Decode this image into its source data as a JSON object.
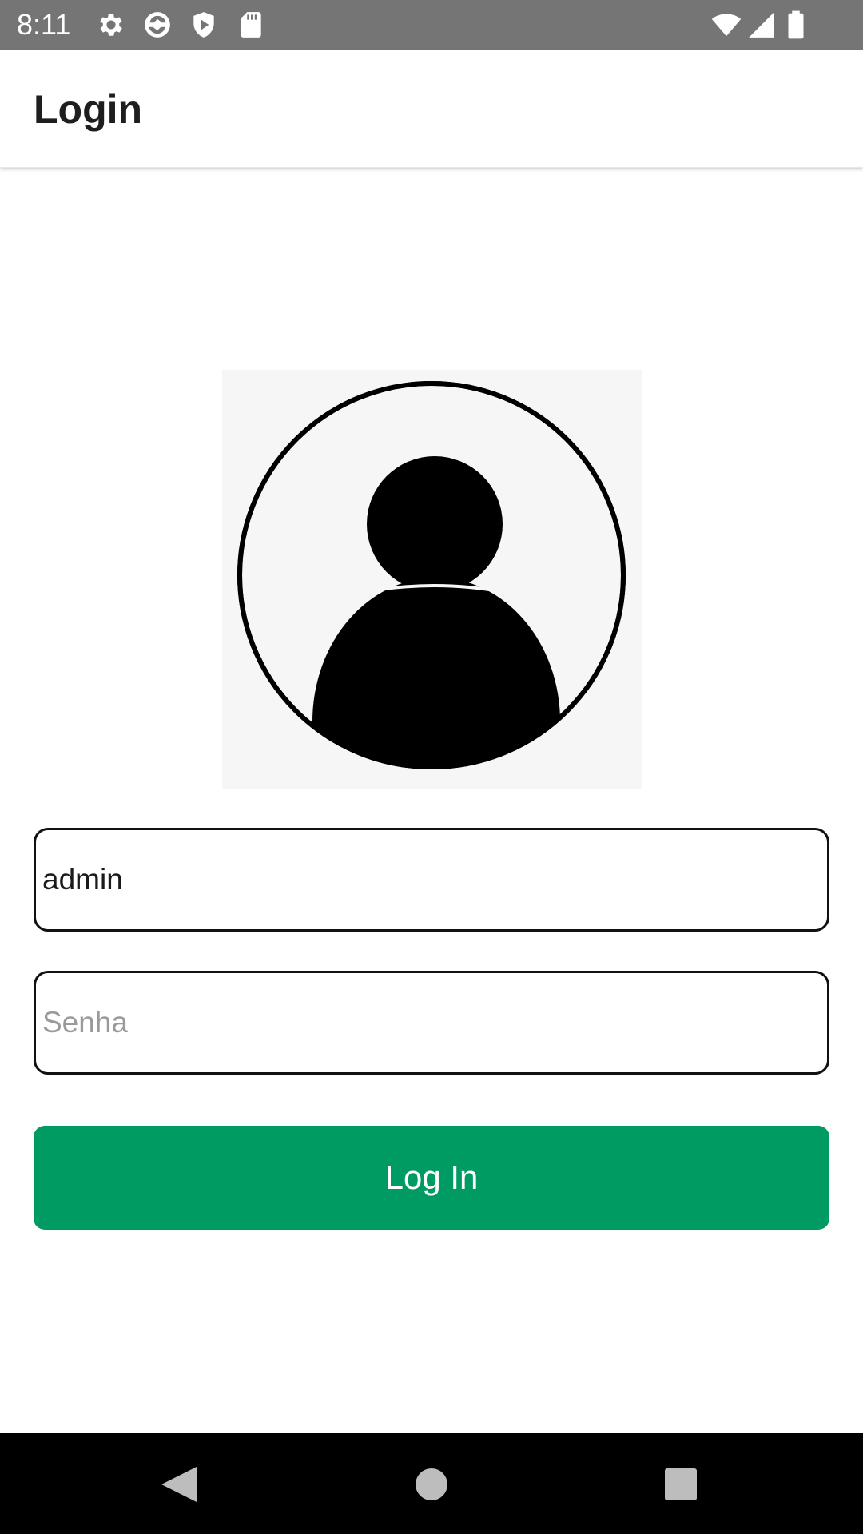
{
  "status_bar": {
    "time": "8:11",
    "icons": [
      "gear-icon",
      "sync-icon",
      "shield-play-icon",
      "sd-card-icon",
      "wifi-icon",
      "cell-signal-icon",
      "battery-icon"
    ]
  },
  "app_bar": {
    "title": "Login"
  },
  "avatar": {
    "icon": "user-avatar-icon"
  },
  "form": {
    "username_value": "admin",
    "password_placeholder": "Senha",
    "login_label": "Log In"
  },
  "nav_bar": {
    "icons": [
      "back-icon",
      "home-icon",
      "recents-icon"
    ]
  },
  "colors": {
    "status_bar": "#757575",
    "button": "#009b62",
    "nav_bar": "#000000",
    "avatar_bg": "#f6f6f6"
  }
}
